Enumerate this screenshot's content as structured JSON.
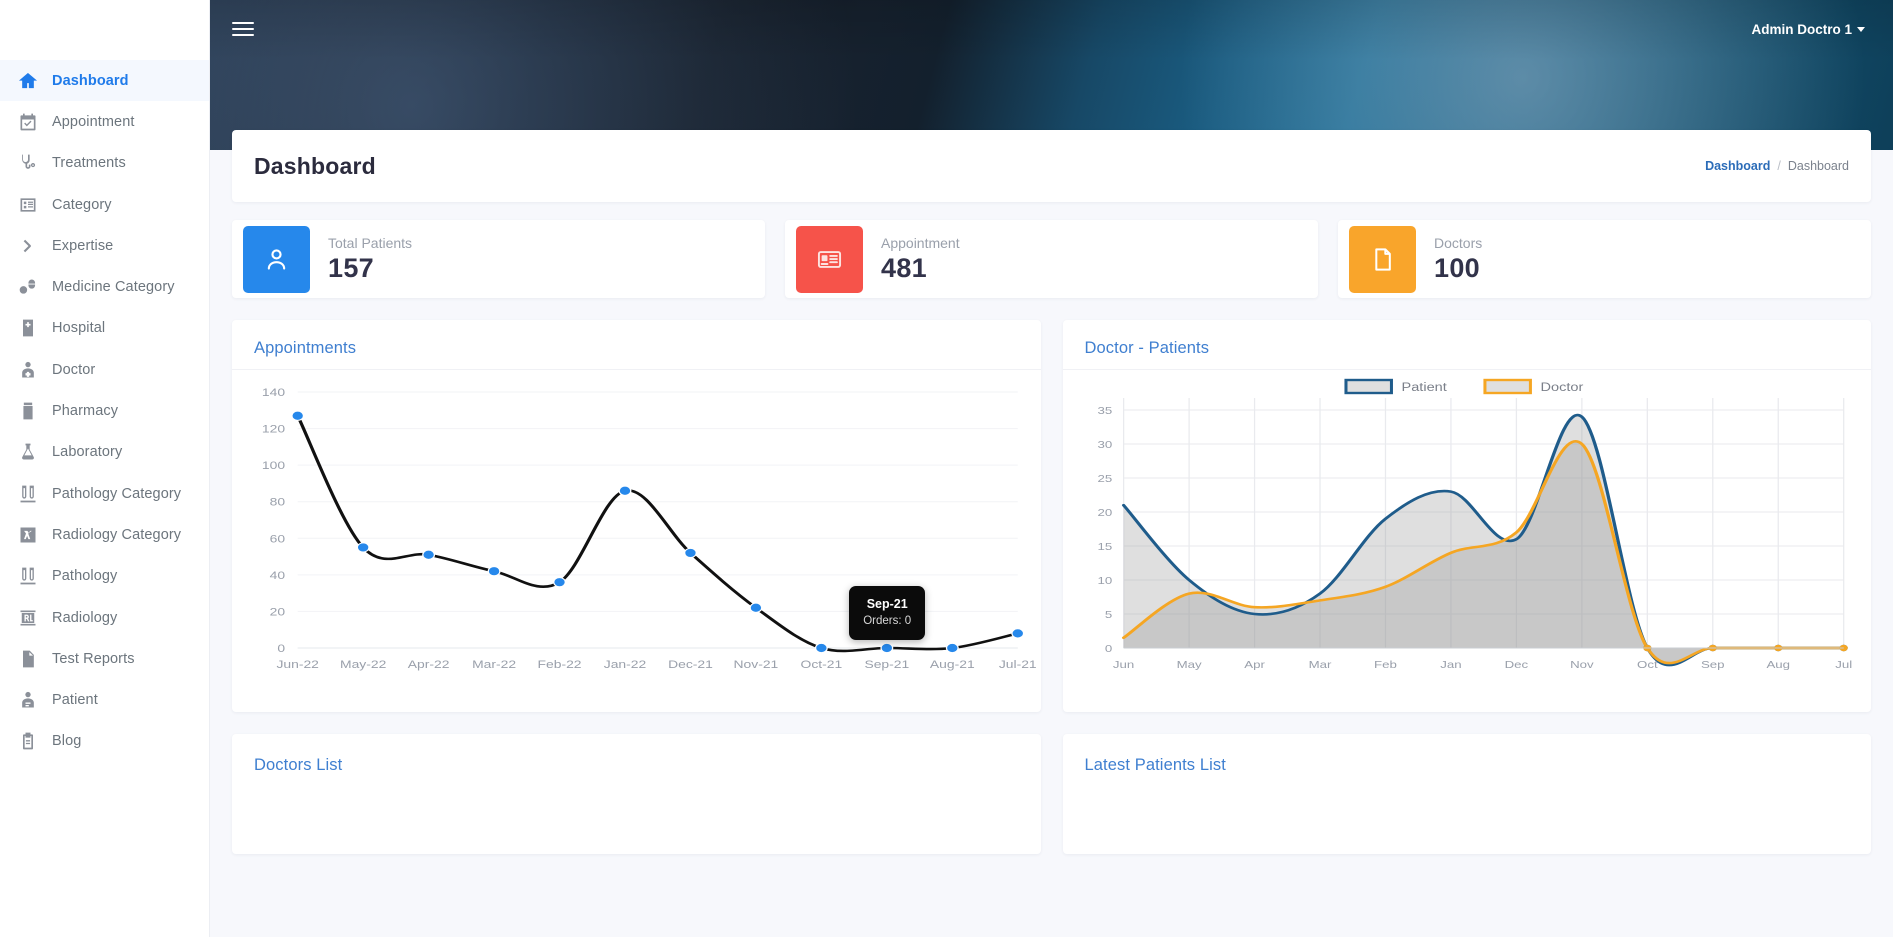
{
  "sidebar": {
    "items": [
      {
        "label": "Dashboard",
        "icon": "home-icon",
        "active": true
      },
      {
        "label": "Appointment",
        "icon": "calendar-check-icon",
        "active": false
      },
      {
        "label": "Treatments",
        "icon": "stethoscope-icon",
        "active": false
      },
      {
        "label": "Category",
        "icon": "list-box-icon",
        "active": false
      },
      {
        "label": "Expertise",
        "icon": "chevron-right-icon",
        "active": false
      },
      {
        "label": "Medicine Category",
        "icon": "pills-icon",
        "active": false
      },
      {
        "label": "Hospital",
        "icon": "hospital-building-icon",
        "active": false
      },
      {
        "label": "Doctor",
        "icon": "doctor-icon",
        "active": false
      },
      {
        "label": "Pharmacy",
        "icon": "medicine-bottle-icon",
        "active": false
      },
      {
        "label": "Laboratory",
        "icon": "flask-icon",
        "active": false
      },
      {
        "label": "Pathology Category",
        "icon": "test-tubes-icon",
        "active": false
      },
      {
        "label": "Radiology Category",
        "icon": "xray-box-icon",
        "active": false
      },
      {
        "label": "Pathology",
        "icon": "test-tubes-icon",
        "active": false
      },
      {
        "label": "Radiology",
        "icon": "xray-film-icon",
        "active": false
      },
      {
        "label": "Test Reports",
        "icon": "document-icon",
        "active": false
      },
      {
        "label": "Patient",
        "icon": "patient-icon",
        "active": false
      },
      {
        "label": "Blog",
        "icon": "clipboard-icon",
        "active": false
      }
    ]
  },
  "topbar": {
    "menu_toggle": "hamburger-menu",
    "user_label": "Admin Doctro 1"
  },
  "page": {
    "title": "Dashboard",
    "breadcrumb_link": "Dashboard",
    "breadcrumb_sep": "/",
    "breadcrumb_current": "Dashboard"
  },
  "stats": [
    {
      "label": "Total Patients",
      "value": "157",
      "icon": "user-icon",
      "color": "#2688eb"
    },
    {
      "label": "Appointment",
      "value": "481",
      "icon": "id-card-icon",
      "color": "#f6534a"
    },
    {
      "label": "Doctors",
      "value": "100",
      "icon": "file-icon",
      "color": "#f9a52b"
    }
  ],
  "chart_data": [
    {
      "type": "line",
      "title": "Appointments",
      "xlabel": "",
      "ylabel": "",
      "categories": [
        "Jun-22",
        "May-22",
        "Apr-22",
        "Mar-22",
        "Feb-22",
        "Jan-22",
        "Dec-21",
        "Nov-21",
        "Oct-21",
        "Sep-21",
        "Aug-21",
        "Jul-21"
      ],
      "values": [
        127,
        55,
        51,
        42,
        36,
        86,
        52,
        22,
        0,
        0,
        0,
        8
      ],
      "series": [
        {
          "name": "Orders",
          "values": [
            127,
            55,
            51,
            42,
            36,
            86,
            52,
            22,
            0,
            0,
            0,
            8
          ]
        }
      ],
      "yticks": [
        0,
        20,
        40,
        60,
        80,
        100,
        120,
        140
      ],
      "ylim": [
        0,
        140
      ],
      "grid": false,
      "line_color": "#111111",
      "marker_color": "#2688eb",
      "tooltip": {
        "title": "Sep-21",
        "value": "Orders: 0",
        "at_category": "Sep-21"
      }
    },
    {
      "type": "area",
      "title": "Doctor - Patients",
      "xlabel": "",
      "ylabel": "",
      "categories": [
        "Jun",
        "May",
        "Apr",
        "Mar",
        "Feb",
        "Jan",
        "Dec",
        "Nov",
        "Oct",
        "Sep",
        "Aug",
        "Jul"
      ],
      "series": [
        {
          "name": "Patient",
          "color": "#1f5c8b",
          "values": [
            21,
            10,
            5,
            8,
            19,
            23,
            16,
            34,
            0,
            0,
            0,
            0
          ]
        },
        {
          "name": "Doctor",
          "color": "#f5a623",
          "values": [
            1.5,
            8,
            6,
            7,
            9,
            14,
            17,
            30,
            0,
            0,
            0,
            0
          ]
        }
      ],
      "yticks": [
        0,
        5,
        10,
        15,
        20,
        25,
        30,
        35
      ],
      "ylim": [
        0,
        35
      ],
      "grid": true,
      "legend_position": "top-center",
      "legend": [
        "Patient",
        "Doctor"
      ]
    }
  ],
  "bottom": {
    "doctors_list_title": "Doctors List",
    "latest_patients_title": "Latest Patients List"
  }
}
